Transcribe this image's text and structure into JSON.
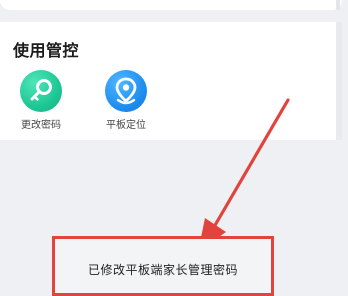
{
  "section": {
    "title": "使用管控"
  },
  "tools": [
    {
      "label": "更改密码",
      "icon": "key-icon",
      "color": "#1fc795"
    },
    {
      "label": "平板定位",
      "icon": "location-pin-icon",
      "color": "#1f8ff0"
    }
  ],
  "annotation": {
    "text": "已修改平板端家长管理密码",
    "color": "#e2433c"
  }
}
